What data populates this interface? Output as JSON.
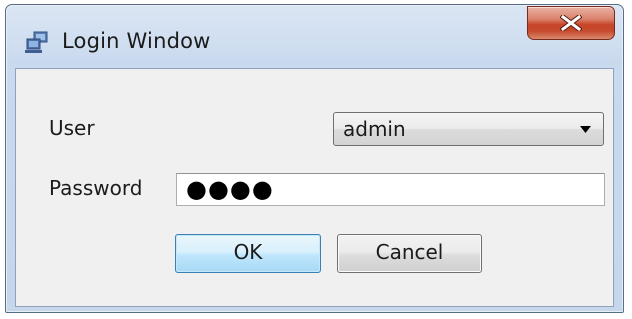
{
  "window": {
    "title": "Login Window",
    "icon": "computer-network-icon",
    "close_icon": "close-icon"
  },
  "form": {
    "user_label": "User",
    "user_value": "admin",
    "password_label": "Password",
    "password_masked": "●●●●"
  },
  "buttons": {
    "ok_label": "OK",
    "cancel_label": "Cancel"
  },
  "colors": {
    "close_button": "#c8452a",
    "default_button_border": "#3c7fb1",
    "titlebar": "#c9d9ee"
  }
}
